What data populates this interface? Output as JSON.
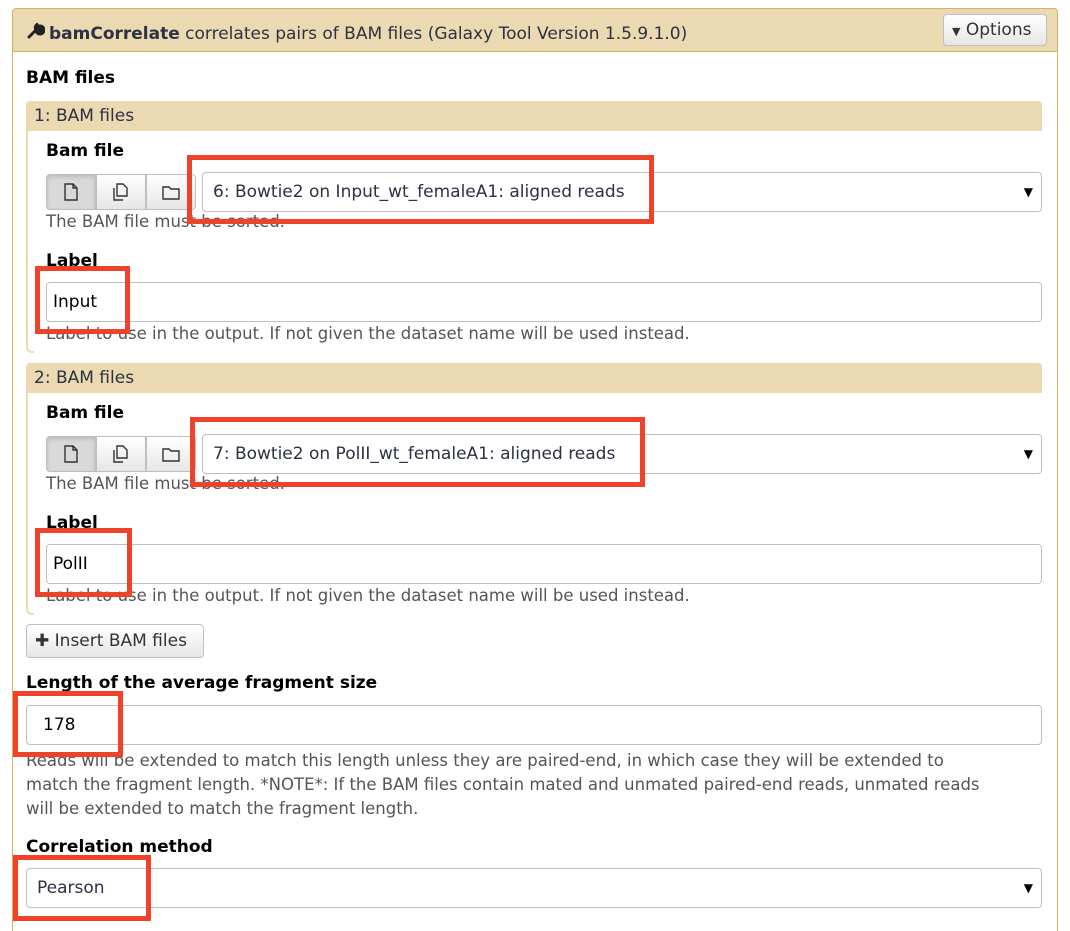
{
  "tool": {
    "name": "bamCorrelate",
    "description": "correlates pairs of BAM files (Galaxy Tool Version 1.5.9.1.0)",
    "options_label": "Options",
    "icon": "wrench-icon"
  },
  "bam_files_section": {
    "label": "BAM files"
  },
  "repeats": [
    {
      "header": "1: BAM files",
      "bam_file_label": "Bam file",
      "bam_file_value": "6: Bowtie2 on Input_wt_femaleA1: aligned reads",
      "bam_file_help": "The BAM file must be sorted.",
      "label_label": "Label",
      "label_value": "Input",
      "label_help": "Label to use in the output. If not given the dataset name will be used instead."
    },
    {
      "header": "2: BAM files",
      "bam_file_label": "Bam file",
      "bam_file_value": "7: Bowtie2 on PolII_wt_femaleA1: aligned reads",
      "bam_file_help": "The BAM file must be sorted.",
      "label_label": "Label",
      "label_value": "PolII",
      "label_help": "Label to use in the output. If not given the dataset name will be used instead."
    }
  ],
  "insert_button": "Insert BAM files",
  "fragment": {
    "label": "Length of the average fragment size",
    "value": "178",
    "help_lines": [
      "Reads will be extended to match this length unless they are paired-end, in which case they will be extended to",
      "match the fragment length. *NOTE*: If the BAM files contain mated and unmated paired-end reads, unmated reads",
      "will be extended to match the fragment length."
    ]
  },
  "correlation": {
    "label": "Correlation method",
    "value": "Pearson"
  },
  "colors": {
    "highlight": "#f0412a",
    "header_bg": "#ebd9b2",
    "border": "#d6b161"
  }
}
